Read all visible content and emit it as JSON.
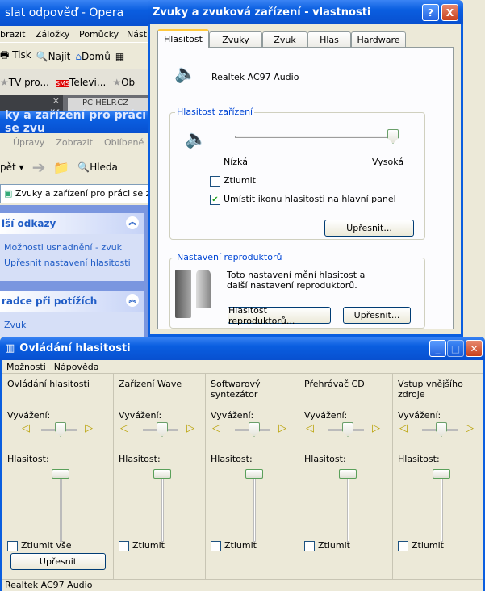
{
  "opera": {
    "title": "slat odpověď - Opera",
    "menu": [
      "brazit",
      "Záložky",
      "Pomůcky",
      "Nást"
    ],
    "toolbar": [
      "Tisk",
      "Najít",
      "Domů"
    ],
    "bookmarks": [
      "TV pro...",
      "Televi...",
      "Ob"
    ],
    "sms": "SMS",
    "tab": "PC HELP.CZ"
  },
  "explorer": {
    "title": "ky a zařízení pro práci se zvu",
    "menu": [
      "Úpravy",
      "Zobrazit",
      "Oblíbené"
    ],
    "back": "pět",
    "search": "Hleda",
    "address": "Zvuky a zařízení pro práci se zvuk",
    "panel1": {
      "title": "lší odkazy",
      "links": [
        "Možnosti usnadnění - zvuk",
        "Upřesnit nastavení hlasitosti"
      ]
    },
    "panel2": {
      "title": "radce při potížích",
      "links": [
        "Zvuk"
      ]
    }
  },
  "dialog": {
    "title": "Zvuky a zvuková zařízení - vlastnosti",
    "help": "?",
    "close": "X",
    "tabs": [
      "Hlasitost",
      "Zvuky",
      "Zvuk",
      "Hlas",
      "Hardware"
    ],
    "device": "Realtek AC97 Audio",
    "volume_group": "Hlasitost zařízení",
    "low": "Nízká",
    "high": "Vysoká",
    "volume_level": 1.0,
    "mute": "Ztlumit",
    "mute_checked": false,
    "tray": "Umístit ikonu hlasitosti na hlavní panel",
    "tray_checked": true,
    "advanced": "Upřesnit...",
    "speaker_group": "Nastavení reproduktorů",
    "speaker_text": "Toto nastavení mění hlasitost a další nastavení reproduktorů.",
    "speaker_volume": "Hlasitost reproduktorů...",
    "speaker_advanced": "Upřesnit..."
  },
  "mixer": {
    "title": "Ovládání hlasitosti",
    "menu": [
      "Možnosti",
      "Nápověda"
    ],
    "balance": "Vyvážení:",
    "volume": "Hlasitost:",
    "channels": [
      {
        "name": "Ovládání hlasitosti",
        "mute": "Ztlumit vše",
        "balance": 0,
        "level": 1.0
      },
      {
        "name": "Zařízení Wave",
        "mute": "Ztlumit",
        "balance": 0,
        "level": 1.0
      },
      {
        "name": "Softwarový syntezátor",
        "mute": "Ztlumit",
        "balance": 0,
        "level": 1.0
      },
      {
        "name": "Přehrávač CD",
        "mute": "Ztlumit",
        "balance": 0,
        "level": 1.0
      },
      {
        "name": "Vstup vnějšího zdroje",
        "mute": "Ztlumit",
        "balance": 0,
        "level": 1.0
      }
    ],
    "advanced": "Upřesnit",
    "status": "Realtek AC97 Audio"
  }
}
